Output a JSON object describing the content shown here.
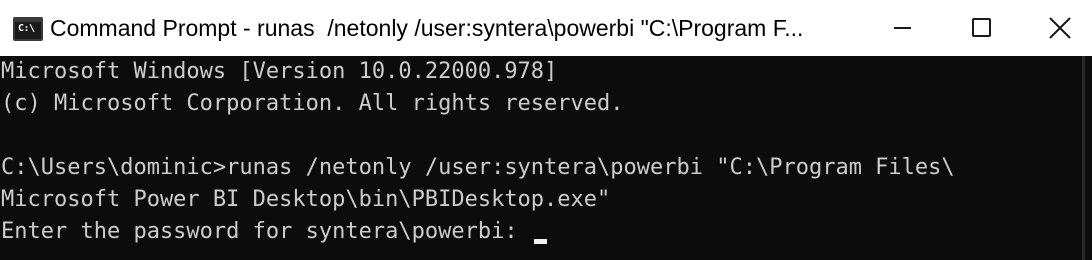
{
  "window": {
    "title": "Command Prompt - runas  /netonly /user:syntera\\powerbi \"C:\\Program F...",
    "icon": "cmd-icon",
    "icon_glyph": "C:\\",
    "controls": [
      "minimize-icon",
      "maximize-icon",
      "close-icon"
    ]
  },
  "console": {
    "lines": [
      "Microsoft Windows [Version 10.0.22000.978]",
      "(c) Microsoft Corporation. All rights reserved.",
      "",
      "C:\\Users\\dominic>runas /netonly /user:syntera\\powerbi \"C:\\Program Files\\",
      "Microsoft Power BI Desktop\\bin\\PBIDesktop.exe\"",
      "Enter the password for syntera\\powerbi: "
    ]
  },
  "colors": {
    "titlebar_bg": "#ffffff",
    "console_bg": "#0c0c0c",
    "console_text": "#cccccc",
    "cursor": "#f2f2f2"
  }
}
